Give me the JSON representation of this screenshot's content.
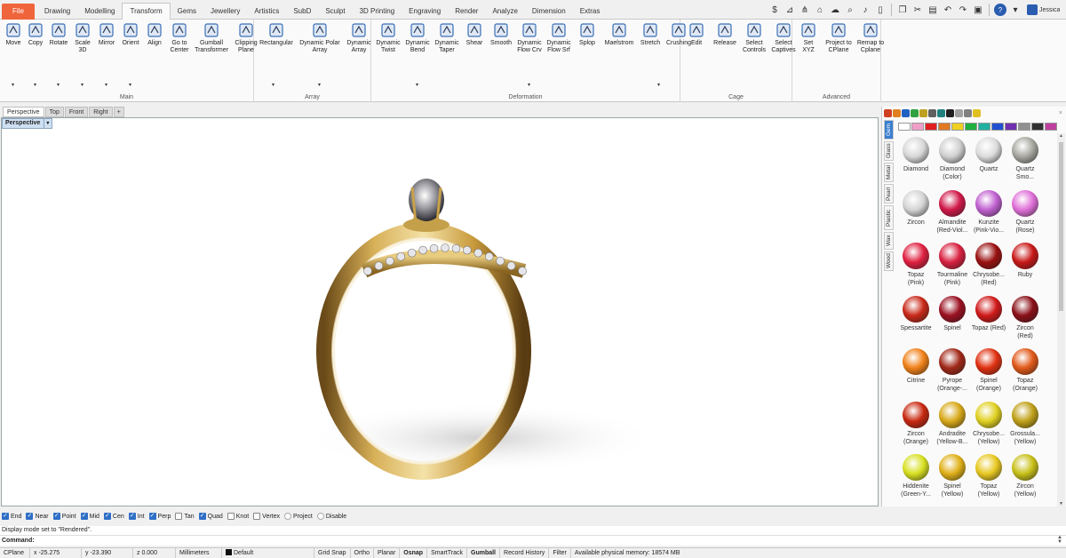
{
  "tabs": [
    {
      "label": "File",
      "state": "file"
    },
    {
      "label": "Drawing"
    },
    {
      "label": "Modelling"
    },
    {
      "label": "Transform",
      "state": "active"
    },
    {
      "label": "Gems"
    },
    {
      "label": "Jewellery"
    },
    {
      "label": "Artistics"
    },
    {
      "label": "SubD"
    },
    {
      "label": "Sculpt"
    },
    {
      "label": "3D Printing"
    },
    {
      "label": "Engraving"
    },
    {
      "label": "Render"
    },
    {
      "label": "Analyze"
    },
    {
      "label": "Dimension"
    },
    {
      "label": "Extras"
    }
  ],
  "user": {
    "name": "Jessica",
    "accent": "#2a5db0"
  },
  "quick_access": [
    "dollar-icon",
    "measure-icon",
    "split-icon",
    "network-icon",
    "cloud-icon",
    "search-icon",
    "microphone-icon",
    "phone-icon",
    "copy-icon",
    "cut-icon",
    "paste-icon",
    "undo-icon",
    "redo-icon",
    "save-icon",
    "help-icon",
    "dropdown-icon"
  ],
  "ribbon": {
    "groups": [
      {
        "label": "Main",
        "tools": [
          "Move",
          "Copy",
          "Rotate",
          "Scale\n3D",
          "Mirror",
          "Orient",
          "Align",
          "Go to\nCenter",
          "Gumball\nTransformer",
          "Clipping\nPlane"
        ]
      },
      {
        "label": "Array",
        "tools": [
          "Rectangular",
          "Dynamic Polar\nArray",
          "Dynamic\nArray"
        ]
      },
      {
        "label": "Deformation",
        "tools": [
          "Dynamic\nTwist",
          "Dynamic\nBend",
          "Dynamic\nTaper",
          "Shear",
          "Smooth",
          "Dynamic\nFlow Crv",
          "Dynamic\nFlow Srf",
          "Splop",
          "Maelstrom",
          "Stretch",
          "Crushing"
        ]
      },
      {
        "label": "Cage",
        "tools": [
          "Edit",
          "Release",
          "Select\nControls",
          "Select\nCaptives"
        ]
      },
      {
        "label": "Advanced",
        "tools": [
          "Set\nXYZ",
          "Project to\nCPlane",
          "Remap to\nCplane"
        ]
      }
    ]
  },
  "viewport_tabs": [
    "Perspective",
    "Top",
    "Front",
    "Right",
    "+"
  ],
  "viewport": {
    "label": "Perspective",
    "dropdown": "▾"
  },
  "panel": {
    "close": "×",
    "vertical_tabs": [
      "Gem",
      "Glass",
      "Metal",
      "Pearl",
      "Plastic",
      "Wax",
      "Wood"
    ],
    "active_tab": "Gem",
    "swatches": [
      "#ffffff",
      "#f0a0c8",
      "#e02020",
      "#e07820",
      "#f0d020",
      "#20b040",
      "#20b0a0",
      "#2050d0",
      "#7030b0",
      "#909090",
      "#303030",
      "#c040a0"
    ],
    "gems": [
      {
        "name": "Diamond",
        "color": "#d8d8d8"
      },
      {
        "name": "Diamond\n(Color)",
        "color": "#d0d0d0"
      },
      {
        "name": "Quartz",
        "color": "#dcdcdc"
      },
      {
        "name": "Quartz\nSmo...",
        "color": "#a8a8a0"
      },
      {
        "name": "Zircon",
        "color": "#d4d4d4"
      },
      {
        "name": "Almandite\n(Red-Viol...",
        "color": "#d01848"
      },
      {
        "name": "Kunzite\n(Pink-Vio...",
        "color": "#c060d0"
      },
      {
        "name": "Quartz\n(Rose)",
        "color": "#e070d8"
      },
      {
        "name": "Topaz\n(Pink)",
        "color": "#e02040"
      },
      {
        "name": "Tourmaline\n(Pink)",
        "color": "#d82040"
      },
      {
        "name": "Chrysobe...\n(Red)",
        "color": "#9a1010"
      },
      {
        "name": "Ruby",
        "color": "#c81818"
      },
      {
        "name": "Spessartite",
        "color": "#c82818"
      },
      {
        "name": "Spinel",
        "color": "#9a1020"
      },
      {
        "name": "Topaz (Red)",
        "color": "#d01818"
      },
      {
        "name": "Zircon\n(Red)",
        "color": "#8a1018"
      },
      {
        "name": "Citrine",
        "color": "#f08018"
      },
      {
        "name": "Pyrope\n(Orange-...",
        "color": "#a02818"
      },
      {
        "name": "Spinel\n(Orange)",
        "color": "#e03010"
      },
      {
        "name": "Topaz\n(Orange)",
        "color": "#e05818"
      },
      {
        "name": "Zircon\n(Orange)",
        "color": "#c82810"
      },
      {
        "name": "Andradite\n(Yellow-B...",
        "color": "#d8a818"
      },
      {
        "name": "Chrysobe...\n(Yellow)",
        "color": "#e0d020"
      },
      {
        "name": "Grossula...\n(Yellow)",
        "color": "#c0a018"
      },
      {
        "name": "Hiddenite\n(Green-Y...",
        "color": "#d8e020"
      },
      {
        "name": "Spinel\n(Yellow)",
        "color": "#e0b018"
      },
      {
        "name": "Topaz\n(Yellow)",
        "color": "#e8c820"
      },
      {
        "name": "Zircon\n(Yellow)",
        "color": "#c8c018"
      }
    ]
  },
  "osnaps": [
    {
      "label": "End",
      "on": true
    },
    {
      "label": "Near",
      "on": true
    },
    {
      "label": "Point",
      "on": true
    },
    {
      "label": "Mid",
      "on": true
    },
    {
      "label": "Cen",
      "on": true
    },
    {
      "label": "Int",
      "on": true
    },
    {
      "label": "Perp",
      "on": true
    },
    {
      "label": "Tan",
      "on": false
    },
    {
      "label": "Quad",
      "on": true
    },
    {
      "label": "Knot",
      "on": false
    },
    {
      "label": "Vertex",
      "on": false
    }
  ],
  "osnap_radios": [
    "Project",
    "Disable"
  ],
  "command": {
    "history": "Display mode set to \"Rendered\".",
    "label": "Command:",
    "value": ""
  },
  "status": {
    "cplane": "CPlane",
    "x": "x -25.275",
    "y": "y -23.390",
    "z": "z 0.000",
    "units": "Millimeters",
    "layer": "Default",
    "toggles": [
      {
        "label": "Grid Snap",
        "bold": false
      },
      {
        "label": "Ortho",
        "bold": false
      },
      {
        "label": "Planar",
        "bold": false
      },
      {
        "label": "Osnap",
        "bold": true
      },
      {
        "label": "SmartTrack",
        "bold": false
      },
      {
        "label": "Gumball",
        "bold": true
      },
      {
        "label": "Record History",
        "bold": false
      },
      {
        "label": "Filter",
        "bold": false
      }
    ],
    "memory": "Available physical memory: 18574 MB"
  }
}
